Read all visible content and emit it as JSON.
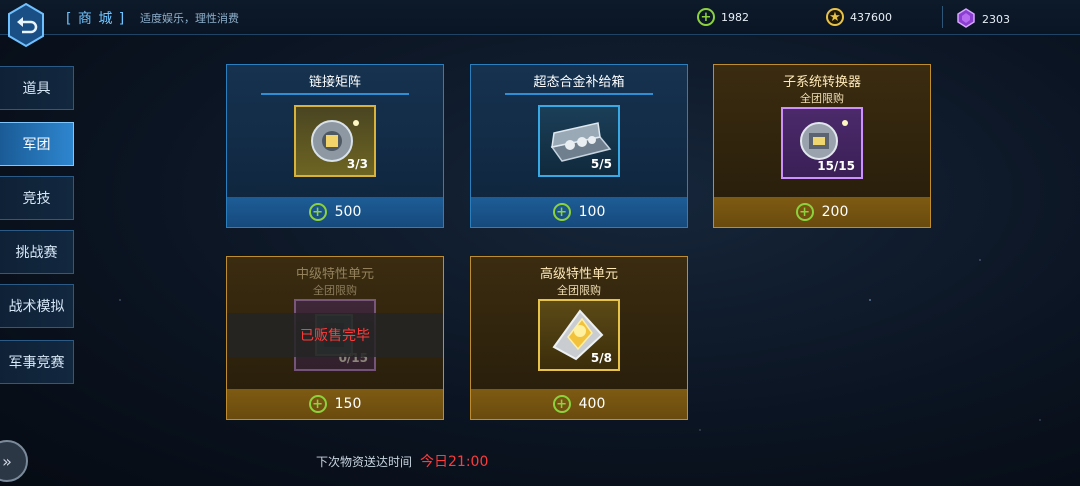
{
  "header": {
    "title": "[ 商 城 ]",
    "subtitle": "适度娱乐，理性消费",
    "resources": [
      {
        "icon": "green-coin-icon",
        "value": "1982"
      },
      {
        "icon": "gold-coin-icon",
        "value": "437600"
      },
      {
        "icon": "purple-crystal-icon",
        "value": "2303"
      }
    ]
  },
  "sidebar": {
    "items": [
      {
        "label": "道具",
        "active": false
      },
      {
        "label": "军团",
        "active": true
      },
      {
        "label": "竞技",
        "active": false
      },
      {
        "label": "挑战赛",
        "active": false
      },
      {
        "label": "战术模拟",
        "active": false
      },
      {
        "label": "军事竞赛",
        "active": false
      }
    ]
  },
  "shop": {
    "items": [
      {
        "name": "链接矩阵",
        "limit": "",
        "stock": "3/3",
        "price": "500",
        "style": "blue",
        "icon": "matrix-device-icon",
        "sold_out": false
      },
      {
        "name": "超态合金补给箱",
        "limit": "",
        "stock": "5/5",
        "price": "100",
        "style": "blue",
        "icon": "alloy-supply-box-icon",
        "sold_out": false
      },
      {
        "name": "子系统转换器",
        "limit": "全团限购",
        "stock": "15/15",
        "price": "200",
        "style": "gold",
        "icon": "subsystem-converter-icon",
        "sold_out": false
      },
      {
        "name": "中级特性单元",
        "limit": "全团限购",
        "stock": "0/15",
        "price": "150",
        "style": "gold",
        "icon": "mid-trait-unit-icon",
        "sold_out": true,
        "sold_out_label": "已贩售完毕"
      },
      {
        "name": "高级特性单元",
        "limit": "全团限购",
        "stock": "5/8",
        "price": "400",
        "style": "gold",
        "icon": "advanced-trait-unit-icon",
        "sold_out": false
      }
    ]
  },
  "footer": {
    "label": "下次物资送达时间",
    "time": "今日21:00"
  },
  "colors": {
    "accent_blue": "#2e86cf",
    "accent_gold": "#c08d2e",
    "sold_out_red": "#ff3b3b",
    "currency_green": "#8cd23c"
  }
}
